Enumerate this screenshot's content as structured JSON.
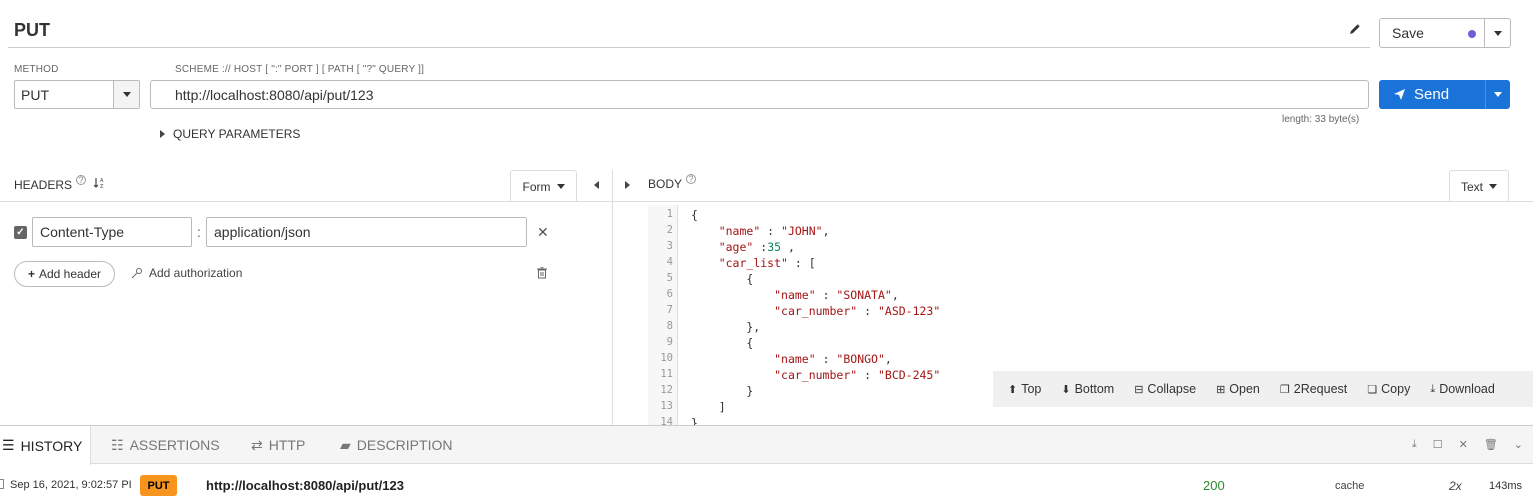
{
  "request": {
    "title": "PUT",
    "save_label": "Save",
    "method_label": "METHOD",
    "url_label": "SCHEME :// HOST [ \":\" PORT ] [ PATH [ \"?\" QUERY ]]",
    "method_value": "PUT",
    "url_value": "http://localhost:8080/api/put/123",
    "send_label": "Send",
    "length_text": "length: 33 byte(s)",
    "query_params_label": "QUERY PARAMETERS"
  },
  "headers": {
    "title": "HEADERS",
    "help": "?",
    "sort_icon_text": "↓A Z",
    "mode_label": "Form",
    "rows": [
      {
        "enabled": true,
        "key": "Content-Type",
        "value": "application/json"
      }
    ],
    "add_header_label": "Add header",
    "add_auth_label": "Add authorization"
  },
  "body": {
    "title": "BODY",
    "help": "?",
    "mode_label": "Text",
    "line_numbers": [
      "1",
      "2",
      "3",
      "4",
      "5",
      "6",
      "7",
      "8",
      "9",
      "10",
      "11",
      "12",
      "13",
      "14"
    ],
    "toolbar": {
      "top": "Top",
      "bottom": "Bottom",
      "collapse": "Collapse",
      "open": "Open",
      "to_request": "2Request",
      "copy": "Copy",
      "download": "Download"
    }
  },
  "bottom_tabs": {
    "history": "HISTORY",
    "assertions": "ASSERTIONS",
    "http": "HTTP",
    "description": "DESCRIPTION"
  },
  "history_row": {
    "date": "Sep 16, 2021, 9:02:57 PI",
    "method": "PUT",
    "url": "http://localhost:8080/api/put/123",
    "status": "200",
    "cache": "cache",
    "count": "2x",
    "time": "143ms"
  },
  "colors": {
    "send": "#1a73d9",
    "method_badge": "#f7941d",
    "status_ok": "#2e8b2e",
    "json_string": "#a31515",
    "json_number": "#098658"
  }
}
